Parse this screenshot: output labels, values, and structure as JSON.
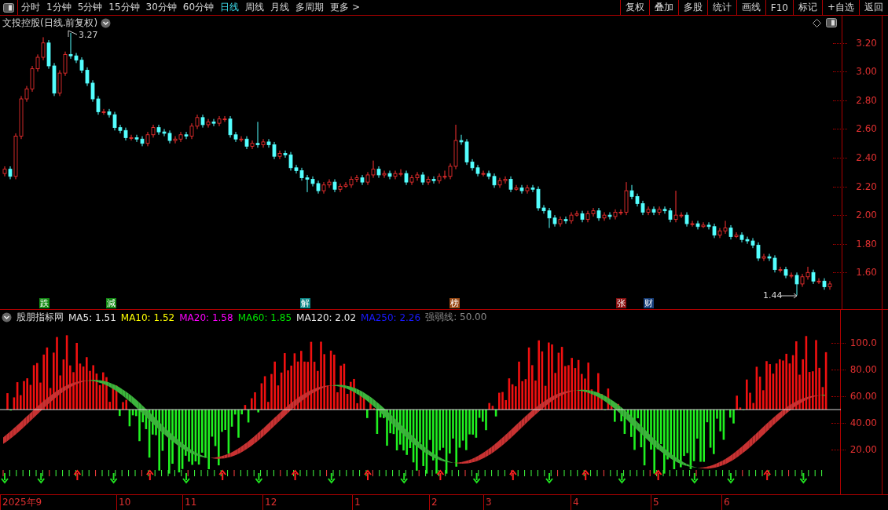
{
  "toolbar": {
    "periods": [
      {
        "label": "分时",
        "selected": false
      },
      {
        "label": "1分钟",
        "selected": false
      },
      {
        "label": "5分钟",
        "selected": false
      },
      {
        "label": "15分钟",
        "selected": false
      },
      {
        "label": "30分钟",
        "selected": false
      },
      {
        "label": "60分钟",
        "selected": false
      },
      {
        "label": "日线",
        "selected": true
      },
      {
        "label": "周线",
        "selected": false
      },
      {
        "label": "月线",
        "selected": false
      },
      {
        "label": "多周期",
        "selected": false
      },
      {
        "label": "更多 >",
        "selected": false
      }
    ],
    "buttons": [
      "复权",
      "叠加",
      "多股",
      "统计",
      "画线",
      "F10",
      "标记",
      "+自选",
      "返回"
    ]
  },
  "chart": {
    "title": "文投控股(日线.前复权)",
    "high_label": "3.27",
    "low_label": "1.44",
    "events": [
      {
        "label": "跌",
        "color": "#138a13"
      },
      {
        "label": "減",
        "color": "#138a13"
      },
      {
        "label": "解",
        "color": "#0e8a8a"
      },
      {
        "label": "榜",
        "color": "#9a4a14"
      },
      {
        "label": "张",
        "color": "#8a1010"
      },
      {
        "label": "财",
        "color": "#173f7a"
      }
    ],
    "chart_data": {
      "type": "candlestick",
      "ylim": [
        1.35,
        3.39
      ],
      "yticks": [
        {
          "value": 3.2,
          "label": "3.20"
        },
        {
          "value": 3.0,
          "label": "3.00"
        },
        {
          "value": 2.8,
          "label": "2.80"
        },
        {
          "value": 2.6,
          "label": "2.60"
        },
        {
          "value": 2.4,
          "label": "2.40"
        },
        {
          "value": 2.2,
          "label": "2.20"
        },
        {
          "value": 2.0,
          "label": "2.00"
        },
        {
          "value": 1.8,
          "label": "1.80"
        },
        {
          "value": 1.6,
          "label": "1.60"
        }
      ],
      "ohlc": [
        [
          2.29,
          2.34,
          2.27,
          2.32
        ],
        [
          2.32,
          2.34,
          2.25,
          2.27
        ],
        [
          2.27,
          2.57,
          2.25,
          2.55
        ],
        [
          2.55,
          2.83,
          2.53,
          2.81
        ],
        [
          2.81,
          2.9,
          2.79,
          2.88
        ],
        [
          2.88,
          3.04,
          2.86,
          3.02
        ],
        [
          3.02,
          3.12,
          3.0,
          3.1
        ],
        [
          3.1,
          3.24,
          3.08,
          3.2
        ],
        [
          3.2,
          3.22,
          3.02,
          3.04
        ],
        [
          3.04,
          3.06,
          2.83,
          2.85
        ],
        [
          2.85,
          3.01,
          2.83,
          2.99
        ],
        [
          2.99,
          3.14,
          2.97,
          3.12
        ],
        [
          3.12,
          3.27,
          3.09,
          3.11
        ],
        [
          3.11,
          3.13,
          3.06,
          3.08
        ],
        [
          3.08,
          3.1,
          2.99,
          3.01
        ],
        [
          3.01,
          3.03,
          2.9,
          2.92
        ],
        [
          2.92,
          2.94,
          2.79,
          2.81
        ],
        [
          2.81,
          2.83,
          2.7,
          2.72
        ],
        [
          2.72,
          2.74,
          2.7,
          2.72
        ],
        [
          2.72,
          2.74,
          2.68,
          2.7
        ],
        [
          2.7,
          2.72,
          2.59,
          2.61
        ],
        [
          2.61,
          2.63,
          2.57,
          2.59
        ],
        [
          2.59,
          2.61,
          2.52,
          2.54
        ],
        [
          2.54,
          2.56,
          2.52,
          2.54
        ],
        [
          2.54,
          2.56,
          2.51,
          2.53
        ],
        [
          2.53,
          2.55,
          2.48,
          2.5
        ],
        [
          2.5,
          2.58,
          2.48,
          2.56
        ],
        [
          2.56,
          2.63,
          2.54,
          2.61
        ],
        [
          2.61,
          2.63,
          2.56,
          2.58
        ],
        [
          2.58,
          2.6,
          2.55,
          2.57
        ],
        [
          2.57,
          2.59,
          2.5,
          2.52
        ],
        [
          2.52,
          2.55,
          2.5,
          2.53
        ],
        [
          2.53,
          2.58,
          2.51,
          2.56
        ],
        [
          2.56,
          2.58,
          2.53,
          2.55
        ],
        [
          2.55,
          2.64,
          2.53,
          2.62
        ],
        [
          2.62,
          2.7,
          2.6,
          2.68
        ],
        [
          2.68,
          2.7,
          2.61,
          2.63
        ],
        [
          2.63,
          2.67,
          2.61,
          2.65
        ],
        [
          2.65,
          2.67,
          2.62,
          2.64
        ],
        [
          2.64,
          2.69,
          2.62,
          2.67
        ],
        [
          2.67,
          2.69,
          2.65,
          2.67
        ],
        [
          2.67,
          2.69,
          2.54,
          2.56
        ],
        [
          2.56,
          2.58,
          2.51,
          2.53
        ],
        [
          2.53,
          2.55,
          2.51,
          2.53
        ],
        [
          2.53,
          2.55,
          2.46,
          2.48
        ],
        [
          2.48,
          2.52,
          2.46,
          2.5
        ],
        [
          2.5,
          2.65,
          2.47,
          2.49
        ],
        [
          2.49,
          2.53,
          2.47,
          2.51
        ],
        [
          2.51,
          2.53,
          2.47,
          2.49
        ],
        [
          2.49,
          2.51,
          2.39,
          2.41
        ],
        [
          2.41,
          2.45,
          2.39,
          2.43
        ],
        [
          2.43,
          2.45,
          2.4,
          2.42
        ],
        [
          2.42,
          2.44,
          2.31,
          2.33
        ],
        [
          2.33,
          2.35,
          2.29,
          2.31
        ],
        [
          2.31,
          2.33,
          2.24,
          2.26
        ],
        [
          2.26,
          2.28,
          2.16,
          2.25
        ],
        [
          2.25,
          2.27,
          2.2,
          2.22
        ],
        [
          2.22,
          2.24,
          2.15,
          2.17
        ],
        [
          2.17,
          2.23,
          2.15,
          2.21
        ],
        [
          2.21,
          2.25,
          2.19,
          2.23
        ],
        [
          2.23,
          2.25,
          2.16,
          2.18
        ],
        [
          2.18,
          2.22,
          2.16,
          2.2
        ],
        [
          2.2,
          2.23,
          2.19,
          2.21
        ],
        [
          2.21,
          2.27,
          2.19,
          2.25
        ],
        [
          2.25,
          2.28,
          2.23,
          2.26
        ],
        [
          2.26,
          2.28,
          2.21,
          2.23
        ],
        [
          2.23,
          2.3,
          2.21,
          2.28
        ],
        [
          2.28,
          2.38,
          2.26,
          2.32
        ],
        [
          2.32,
          2.34,
          2.26,
          2.28
        ],
        [
          2.28,
          2.31,
          2.26,
          2.29
        ],
        [
          2.29,
          2.31,
          2.25,
          2.27
        ],
        [
          2.27,
          2.31,
          2.25,
          2.29
        ],
        [
          2.29,
          2.32,
          2.27,
          2.29
        ],
        [
          2.29,
          2.31,
          2.21,
          2.23
        ],
        [
          2.23,
          2.28,
          2.21,
          2.26
        ],
        [
          2.26,
          2.3,
          2.24,
          2.28
        ],
        [
          2.28,
          2.3,
          2.21,
          2.23
        ],
        [
          2.23,
          2.27,
          2.21,
          2.25
        ],
        [
          2.25,
          2.27,
          2.22,
          2.24
        ],
        [
          2.24,
          2.29,
          2.22,
          2.27
        ],
        [
          2.27,
          2.31,
          2.25,
          2.27
        ],
        [
          2.27,
          2.36,
          2.25,
          2.34
        ],
        [
          2.34,
          2.63,
          2.32,
          2.52
        ],
        [
          2.52,
          2.56,
          2.49,
          2.51
        ],
        [
          2.51,
          2.53,
          2.35,
          2.37
        ],
        [
          2.37,
          2.39,
          2.31,
          2.33
        ],
        [
          2.33,
          2.35,
          2.27,
          2.29
        ],
        [
          2.29,
          2.31,
          2.27,
          2.29
        ],
        [
          2.29,
          2.31,
          2.25,
          2.27
        ],
        [
          2.27,
          2.29,
          2.19,
          2.21
        ],
        [
          2.21,
          2.26,
          2.19,
          2.24
        ],
        [
          2.24,
          2.27,
          2.22,
          2.25
        ],
        [
          2.25,
          2.27,
          2.16,
          2.18
        ],
        [
          2.18,
          2.21,
          2.17,
          2.19
        ],
        [
          2.19,
          2.21,
          2.15,
          2.17
        ],
        [
          2.17,
          2.21,
          2.15,
          2.19
        ],
        [
          2.19,
          2.21,
          2.16,
          2.18
        ],
        [
          2.18,
          2.2,
          2.03,
          2.05
        ],
        [
          2.05,
          2.07,
          2.01,
          2.03
        ],
        [
          2.03,
          2.05,
          1.91,
          1.98
        ],
        [
          1.98,
          2.0,
          1.92,
          1.94
        ],
        [
          1.94,
          1.99,
          1.92,
          1.97
        ],
        [
          1.97,
          1.99,
          1.94,
          1.96
        ],
        [
          1.96,
          2.02,
          1.94,
          2.0
        ],
        [
          2.0,
          2.03,
          1.99,
          2.01
        ],
        [
          2.01,
          2.03,
          1.95,
          1.97
        ],
        [
          1.97,
          2.03,
          1.95,
          2.01
        ],
        [
          2.01,
          2.05,
          1.99,
          2.03
        ],
        [
          2.03,
          2.05,
          1.96,
          1.98
        ],
        [
          1.98,
          2.02,
          1.96,
          2.0
        ],
        [
          2.0,
          2.02,
          1.97,
          1.99
        ],
        [
          1.99,
          2.04,
          1.97,
          2.02
        ],
        [
          2.02,
          2.04,
          2.0,
          2.02
        ],
        [
          2.02,
          2.23,
          2.0,
          2.17
        ],
        [
          2.17,
          2.21,
          2.11,
          2.13
        ],
        [
          2.13,
          2.15,
          2.06,
          2.08
        ],
        [
          2.08,
          2.1,
          2.0,
          2.02
        ],
        [
          2.02,
          2.06,
          2.0,
          2.04
        ],
        [
          2.04,
          2.06,
          2.0,
          2.02
        ],
        [
          2.02,
          2.06,
          2.0,
          2.04
        ],
        [
          2.04,
          2.06,
          2.01,
          2.03
        ],
        [
          2.03,
          2.05,
          1.95,
          1.97
        ],
        [
          1.97,
          2.17,
          1.95,
          2.0
        ],
        [
          2.0,
          2.02,
          1.98,
          2.0
        ],
        [
          2.0,
          2.02,
          1.92,
          1.94
        ],
        [
          1.94,
          1.96,
          1.92,
          1.94
        ],
        [
          1.94,
          1.96,
          1.9,
          1.92
        ],
        [
          1.92,
          1.95,
          1.91,
          1.93
        ],
        [
          1.93,
          1.95,
          1.9,
          1.92
        ],
        [
          1.92,
          1.94,
          1.84,
          1.86
        ],
        [
          1.86,
          1.91,
          1.84,
          1.89
        ],
        [
          1.89,
          1.96,
          1.87,
          1.91
        ],
        [
          1.91,
          1.93,
          1.83,
          1.85
        ],
        [
          1.85,
          1.88,
          1.84,
          1.86
        ],
        [
          1.86,
          1.88,
          1.81,
          1.83
        ],
        [
          1.83,
          1.85,
          1.8,
          1.82
        ],
        [
          1.82,
          1.84,
          1.77,
          1.79
        ],
        [
          1.79,
          1.81,
          1.68,
          1.7
        ],
        [
          1.7,
          1.73,
          1.68,
          1.71
        ],
        [
          1.71,
          1.73,
          1.68,
          1.7
        ],
        [
          1.7,
          1.72,
          1.6,
          1.62
        ],
        [
          1.62,
          1.64,
          1.6,
          1.62
        ],
        [
          1.62,
          1.64,
          1.56,
          1.58
        ],
        [
          1.58,
          1.6,
          1.56,
          1.58
        ],
        [
          1.58,
          1.6,
          1.44,
          1.52
        ],
        [
          1.52,
          1.59,
          1.5,
          1.57
        ],
        [
          1.57,
          1.64,
          1.55,
          1.6
        ],
        [
          1.6,
          1.62,
          1.52,
          1.54
        ],
        [
          1.54,
          1.56,
          1.52,
          1.54
        ],
        [
          1.54,
          1.56,
          1.48,
          1.5
        ],
        [
          1.5,
          1.54,
          1.48,
          1.52
        ]
      ]
    }
  },
  "indicator": {
    "name": "股朋指标网",
    "values": [
      {
        "label": "MA5: 1.51",
        "color": "#e6e6e6"
      },
      {
        "label": "MA10: 1.52",
        "color": "#ffff00"
      },
      {
        "label": "MA20: 1.58",
        "color": "#ff00ff"
      },
      {
        "label": "MA60: 1.85",
        "color": "#00e000"
      },
      {
        "label": "MA120: 2.02",
        "color": "#e6e6e6"
      },
      {
        "label": "MA250: 2.26",
        "color": "#1a1aff"
      },
      {
        "label": "强弱线: 50.00",
        "color": "#8c8c8c"
      }
    ],
    "axis": [
      "100.0",
      "80.00",
      "60.00",
      "40.00",
      "20.00"
    ]
  },
  "time_axis": [
    "2025年9",
    "10",
    "11",
    "12",
    "1",
    "2",
    "3",
    "4",
    "5",
    "6"
  ]
}
